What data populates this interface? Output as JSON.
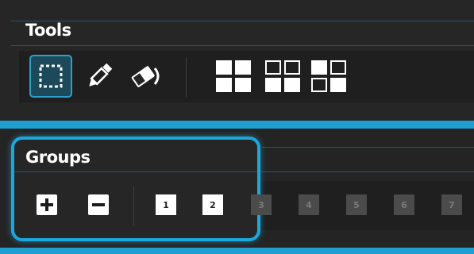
{
  "tools": {
    "title": "Tools",
    "buttons": [
      {
        "name": "select-tool",
        "icon": "dashed-square-icon",
        "active": true
      },
      {
        "name": "pencil-tool",
        "icon": "pencil-icon"
      },
      {
        "name": "eraser-tool",
        "icon": "eraser-icon"
      },
      {
        "name": "grid-full",
        "icon": "grid-all-filled-icon"
      },
      {
        "name": "grid-empty-top",
        "icon": "grid-top-outline-icon"
      },
      {
        "name": "grid-mixed",
        "icon": "grid-mixed-icon"
      }
    ]
  },
  "groups": {
    "title": "Groups",
    "add_icon": "plus-icon",
    "remove_icon": "minus-icon",
    "items": [
      {
        "label": "1",
        "active": true
      },
      {
        "label": "2",
        "active": true
      },
      {
        "label": "3",
        "active": false
      },
      {
        "label": "4",
        "active": false
      },
      {
        "label": "5",
        "active": false
      },
      {
        "label": "6",
        "active": false
      },
      {
        "label": "7",
        "active": false
      }
    ]
  },
  "colors": {
    "accent": "#1ba7dc",
    "panel_bg": "#262626",
    "active_tool_bg": "#1d4a5a"
  }
}
